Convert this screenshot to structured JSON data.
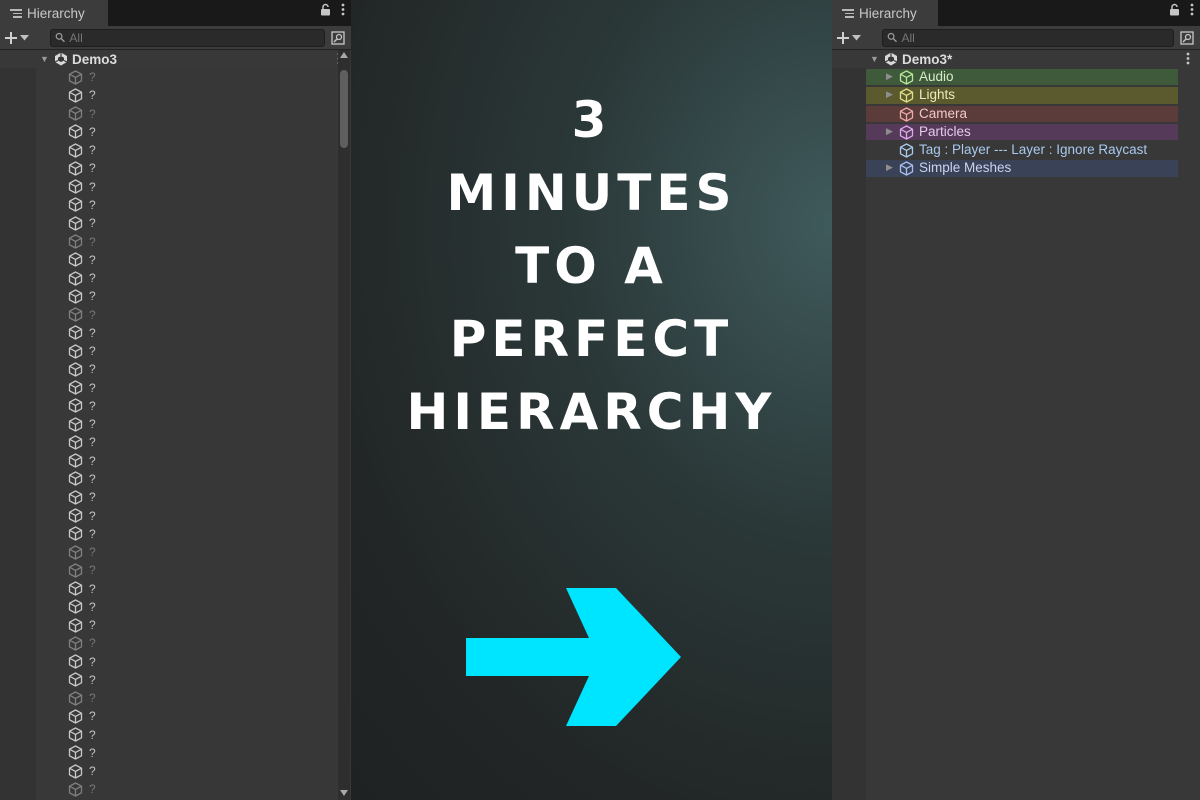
{
  "left_panel": {
    "tab_title": "Hierarchy",
    "search_placeholder": "All",
    "scene_name": "Demo3",
    "item_label": "?",
    "dim_rows": [
      0,
      2,
      9,
      13,
      26,
      27,
      31,
      34,
      39,
      40
    ]
  },
  "center": {
    "title_lines": [
      "3",
      "MINUTES",
      "TO A",
      "PERFECT",
      "HIERARCHY"
    ],
    "arrow_color": "#00e5ff"
  },
  "right_panel": {
    "tab_title": "Hierarchy",
    "search_placeholder": "All",
    "scene_name": "Demo3*",
    "items": [
      {
        "label": "Audio",
        "has_children": true,
        "bg": "#3e5a3a",
        "text_color": "#d8ecc8",
        "icon_color": "#b7e79a"
      },
      {
        "label": "Lights",
        "has_children": true,
        "bg": "#5a5a2e",
        "text_color": "#ecebb8",
        "icon_color": "#e4e08a"
      },
      {
        "label": "Camera",
        "has_children": false,
        "bg": "#5c3b3b",
        "text_color": "#f0c8c8",
        "icon_color": "#f0a8a8"
      },
      {
        "label": "Particles",
        "has_children": true,
        "bg": "#553a5a",
        "text_color": "#e8c8ee",
        "icon_color": "#e0a8ec"
      },
      {
        "label": "Tag : Player --- Layer : Ignore Raycast",
        "has_children": false,
        "bg": "#383838",
        "text_color": "#a9c9ee",
        "icon_color": "#a9c9ee"
      },
      {
        "label": "Simple Meshes",
        "has_children": true,
        "bg": "#3a4258",
        "text_color": "#c8d4ee",
        "icon_color": "#a9bff0"
      }
    ]
  }
}
